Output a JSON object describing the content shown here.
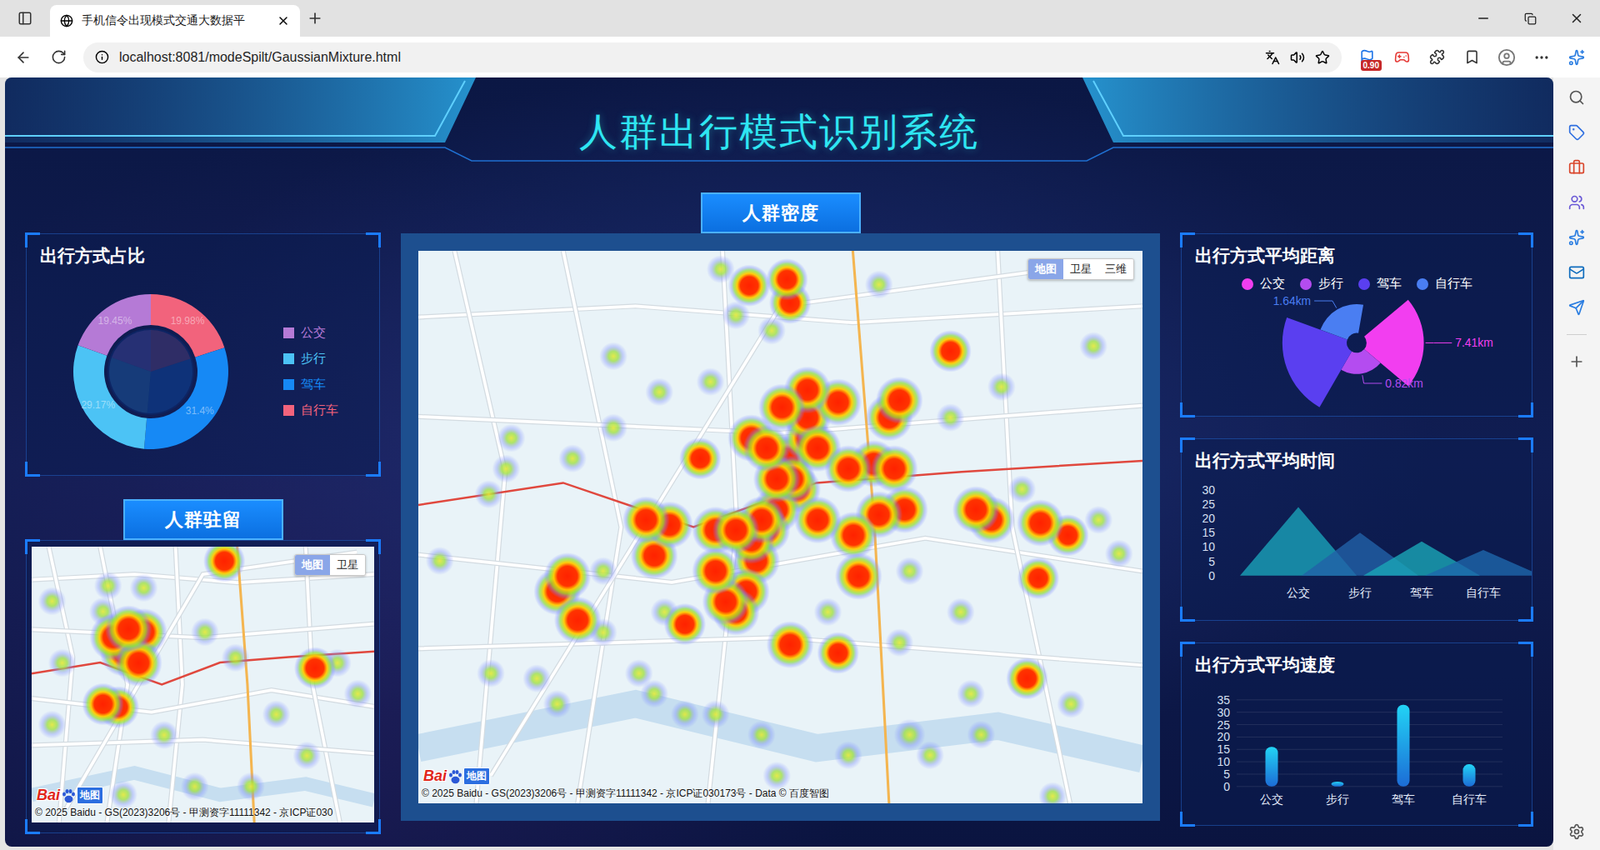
{
  "browser": {
    "tab": {
      "title": "手机信令出现模式交通大数据平",
      "selected": true
    },
    "url": "localhost:8081/modeSpilt/GaussianMixture.html",
    "badge": "0.90"
  },
  "title": "人群出行模式识别系统",
  "share": {
    "title": "出行方式占比",
    "items": [
      {
        "name": "公交",
        "value": 19.45,
        "label": "19.45%",
        "color": "#b57ad6"
      },
      {
        "name": "步行",
        "value": 29.17,
        "label": "29.17%",
        "color": "#4cc3f5"
      },
      {
        "name": "驾车",
        "value": 31.4,
        "label": "31.4%",
        "color": "#1689f5"
      },
      {
        "name": "自行车",
        "value": 19.98,
        "label": "19.98%",
        "color": "#f2637c"
      }
    ]
  },
  "stay": {
    "title": "人群驻留",
    "map": {
      "types": [
        {
          "label": "地图",
          "selected": true
        },
        {
          "label": "卫星",
          "selected": false
        }
      ],
      "logo": {
        "text": "Bai",
        "suffix": "地图"
      },
      "copyright": "© 2025 Baidu - GS(2023)3206号 - 甲测资字11111342 - 京ICP证030",
      "points": [
        [
          100,
          93,
          0.95
        ],
        [
          90,
          103,
          0.95
        ],
        [
          110,
          83,
          0.95
        ],
        [
          80,
          88,
          0.95
        ],
        [
          105,
          113,
          0.95
        ],
        [
          95,
          80,
          0.95
        ],
        [
          189,
          14,
          0.8
        ],
        [
          278,
          118,
          0.8
        ],
        [
          85,
          156,
          0.8
        ],
        [
          70,
          153,
          0.8
        ],
        [
          20,
          53,
          0.4
        ],
        [
          70,
          63,
          0.4
        ],
        [
          110,
          40,
          0.4
        ],
        [
          75,
          38,
          0.4
        ],
        [
          200,
          108,
          0.4
        ],
        [
          130,
          183,
          0.4
        ],
        [
          90,
          241,
          0.4
        ],
        [
          20,
          173,
          0.4
        ],
        [
          215,
          233,
          0.4
        ],
        [
          240,
          163,
          0.4
        ],
        [
          320,
          143,
          0.4
        ],
        [
          300,
          113,
          0.4
        ],
        [
          170,
          83,
          0.4
        ],
        [
          30,
          113,
          0.4
        ],
        [
          160,
          233,
          0.4
        ],
        [
          270,
          203,
          0.4
        ]
      ]
    }
  },
  "density": {
    "title": "人群密度",
    "map": {
      "types": [
        {
          "label": "地图",
          "selected": true
        },
        {
          "label": "卫星",
          "selected": false
        },
        {
          "label": "三维",
          "selected": false
        }
      ],
      "logo": {
        "text": "Bai",
        "suffix": "地图"
      },
      "copyright": "© 2025 Baidu - GS(2023)3206号 - 甲测资字11111342 - 京ICP证030173号 - Data © 百度智图",
      "points": [
        [
          361,
          203,
          0.95
        ],
        [
          381,
          183,
          0.95
        ],
        [
          371,
          233,
          0.95
        ],
        [
          351,
          253,
          0.95
        ],
        [
          341,
          273,
          0.95
        ],
        [
          331,
          303,
          0.95
        ],
        [
          321,
          333,
          0.95
        ],
        [
          311,
          353,
          0.95
        ],
        [
          381,
          163,
          0.95
        ],
        [
          391,
          193,
          0.95
        ],
        [
          366,
          223,
          0.95
        ],
        [
          351,
          223,
          0.95
        ],
        [
          326,
          283,
          0.95
        ],
        [
          336,
          263,
          0.95
        ],
        [
          301,
          343,
          0.95
        ],
        [
          291,
          273,
          0.95
        ],
        [
          311,
          273,
          0.95
        ],
        [
          446,
          208,
          0.95
        ],
        [
          466,
          213,
          0.95
        ],
        [
          476,
          253,
          0.95
        ],
        [
          451,
          258,
          0.95
        ],
        [
          426,
          278,
          0.95
        ],
        [
          411,
          148,
          0.95
        ],
        [
          381,
          136,
          0.95
        ],
        [
          461,
          163,
          0.95
        ],
        [
          521,
          98,
          0.8
        ],
        [
          561,
          263,
          0.95
        ],
        [
          546,
          253,
          0.95
        ],
        [
          609,
          266,
          0.95
        ],
        [
          636,
          278,
          0.8
        ],
        [
          607,
          320,
          0.8
        ],
        [
          596,
          418,
          0.8
        ],
        [
          136,
          333,
          0.95
        ],
        [
          146,
          318,
          0.95
        ],
        [
          156,
          361,
          0.95
        ],
        [
          231,
          298,
          0.95
        ],
        [
          246,
          268,
          0.95
        ],
        [
          223,
          263,
          0.95
        ],
        [
          261,
          365,
          0.8
        ],
        [
          276,
          203,
          0.8
        ],
        [
          326,
          183,
          0.95
        ],
        [
          364,
          51,
          0.8
        ],
        [
          361,
          28,
          0.8
        ],
        [
          324,
          34,
          0.8
        ],
        [
          364,
          385,
          0.95
        ],
        [
          411,
          393,
          0.8
        ],
        [
          431,
          318,
          0.95
        ],
        [
          391,
          263,
          0.95
        ],
        [
          471,
          146,
          0.95
        ],
        [
          356,
          153,
          0.95
        ],
        [
          291,
          313,
          0.95
        ],
        [
          341,
          193,
          0.95
        ],
        [
          421,
          213,
          0.95
        ],
        [
          296,
          18,
          0.4
        ],
        [
          311,
          63,
          0.4
        ],
        [
          346,
          78,
          0.4
        ],
        [
          286,
          128,
          0.4
        ],
        [
          236,
          138,
          0.4
        ],
        [
          191,
          173,
          0.4
        ],
        [
          91,
          183,
          0.4
        ],
        [
          86,
          213,
          0.4
        ],
        [
          69,
          238,
          0.4
        ],
        [
          21,
          303,
          0.4
        ],
        [
          181,
          313,
          0.4
        ],
        [
          181,
          373,
          0.4
        ],
        [
          216,
          413,
          0.4
        ],
        [
          116,
          418,
          0.4
        ],
        [
          136,
          443,
          0.4
        ],
        [
          71,
          413,
          0.4
        ],
        [
          261,
          453,
          0.4
        ],
        [
          336,
          473,
          0.4
        ],
        [
          291,
          453,
          0.4
        ],
        [
          471,
          383,
          0.4
        ],
        [
          531,
          353,
          0.4
        ],
        [
          541,
          433,
          0.4
        ],
        [
          661,
          93,
          0.4
        ],
        [
          686,
          296,
          0.4
        ],
        [
          639,
          443,
          0.4
        ],
        [
          621,
          533,
          0.4
        ],
        [
          551,
          473,
          0.4
        ],
        [
          421,
          493,
          0.4
        ],
        [
          501,
          493,
          0.4
        ],
        [
          451,
          33,
          0.4
        ],
        [
          231,
          433,
          0.4
        ],
        [
          241,
          353,
          0.4
        ],
        [
          401,
          353,
          0.4
        ],
        [
          521,
          163,
          0.4
        ],
        [
          571,
          133,
          0.4
        ],
        [
          591,
          233,
          0.4
        ],
        [
          666,
          263,
          0.4
        ],
        [
          191,
          103,
          0.4
        ],
        [
          151,
          203,
          0.4
        ],
        [
          351,
          513,
          0.4
        ],
        [
          481,
          313,
          0.4
        ],
        [
          481,
          473,
          0.5
        ]
      ]
    }
  },
  "distance": {
    "title": "出行方式平均距离",
    "items": [
      {
        "name": "公交",
        "value": 7.41,
        "label": "7.41km",
        "color": "#f23ef0"
      },
      {
        "name": "步行",
        "value": 0.82,
        "label": "0.82km",
        "color": "#b44cf0"
      },
      {
        "name": "驾车",
        "value": 9.5,
        "color": "#5a3ff0"
      },
      {
        "name": "自行车",
        "value": 1.64,
        "label": "1.64km",
        "color": "#4a7ef2"
      }
    ]
  },
  "time": {
    "title": "出行方式平均时间",
    "ticks": [
      "30",
      "25",
      "20",
      "15",
      "10",
      "5",
      "0"
    ],
    "items": [
      {
        "name": "公交",
        "value": 24,
        "color": "#1aa3b9"
      },
      {
        "name": "步行",
        "value": 15,
        "color": "#2262a8"
      },
      {
        "name": "驾车",
        "value": 12,
        "color": "#1aa6b6"
      },
      {
        "name": "自行车",
        "value": 9,
        "color": "#1e66ab"
      }
    ]
  },
  "speed": {
    "title": "出行方式平均速度",
    "ticks": [
      "35",
      "30",
      "25",
      "20",
      "15",
      "10",
      "5",
      "0"
    ],
    "items": [
      {
        "name": "公交",
        "value": 16
      },
      {
        "name": "步行",
        "value": 2
      },
      {
        "name": "驾车",
        "value": 33
      },
      {
        "name": "自行车",
        "value": 9
      }
    ]
  }
}
